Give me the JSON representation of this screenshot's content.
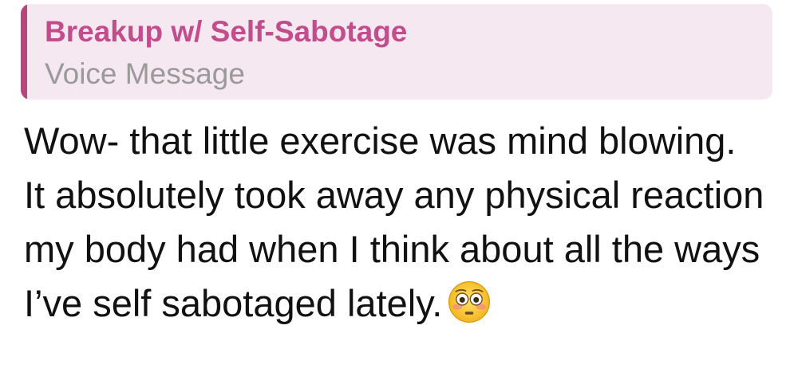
{
  "reply_quote": {
    "title": "Breakup w/ Self-Sabotage",
    "subtitle": "Voice Message",
    "accent_color": "#b4487d",
    "title_color": "#c24c8c",
    "background_color": "#f6e8f0"
  },
  "message": {
    "text": "Wow- that little exercise was mind blowing. It absolutely took away any physical reaction my body had when I think about all the ways I’ve self sabotaged lately.",
    "emoji": "flushed-face-icon"
  }
}
